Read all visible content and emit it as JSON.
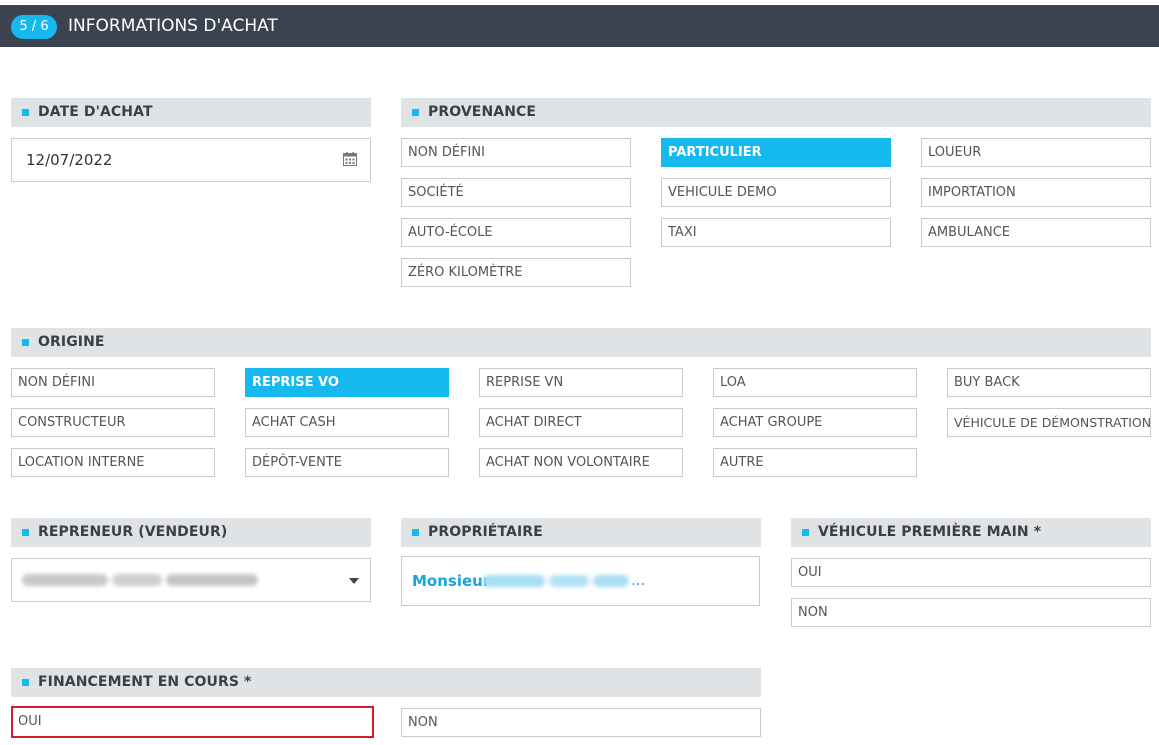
{
  "header": {
    "step": "5 / 6",
    "title": "INFORMATIONS D'ACHAT"
  },
  "date_achat": {
    "label": "DATE D'ACHAT",
    "value": "12/07/2022"
  },
  "provenance": {
    "label": "PROVENANCE",
    "options": [
      "NON DÉFINI",
      "PARTICULIER",
      "LOUEUR",
      "SOCIÉTÉ",
      "VEHICULE DEMO",
      "IMPORTATION",
      "AUTO-ÉCOLE",
      "TAXI",
      "AMBULANCE",
      "ZÉRO KILOMÈTRE"
    ],
    "selected": "PARTICULIER"
  },
  "origine": {
    "label": "ORIGINE",
    "options": [
      "NON DÉFINI",
      "REPRISE VO",
      "REPRISE VN",
      "LOA",
      "BUY BACK",
      "CONSTRUCTEUR",
      "ACHAT CASH",
      "ACHAT DIRECT",
      "ACHAT GROUPE",
      "VÉHICULE DE DÉMONSTRATION",
      "LOCATION INTERNE",
      "DÉPÔT-VENTE",
      "ACHAT NON VOLONTAIRE",
      "AUTRE"
    ],
    "selected": "REPRISE VO"
  },
  "repreneur": {
    "label": "REPRENEUR (VENDEUR)"
  },
  "proprietaire": {
    "label": "PROPRIÉTAIRE",
    "prefix": "Monsieur",
    "suffix": "..."
  },
  "premiere_main": {
    "label": "VÉHICULE PREMIÈRE MAIN *",
    "options": [
      "OUI",
      "NON"
    ]
  },
  "financement": {
    "label": "FINANCEMENT EN COURS *",
    "options": [
      "OUI",
      "NON"
    ],
    "focused": "OUI"
  },
  "colors": {
    "accent": "#16b9ee",
    "header_bg": "#3b4250",
    "section_bg": "#e0e3e6",
    "focus_border": "#cc2027"
  },
  "icons": {
    "date": "calendar-icon",
    "select": "caret-down-icon"
  }
}
